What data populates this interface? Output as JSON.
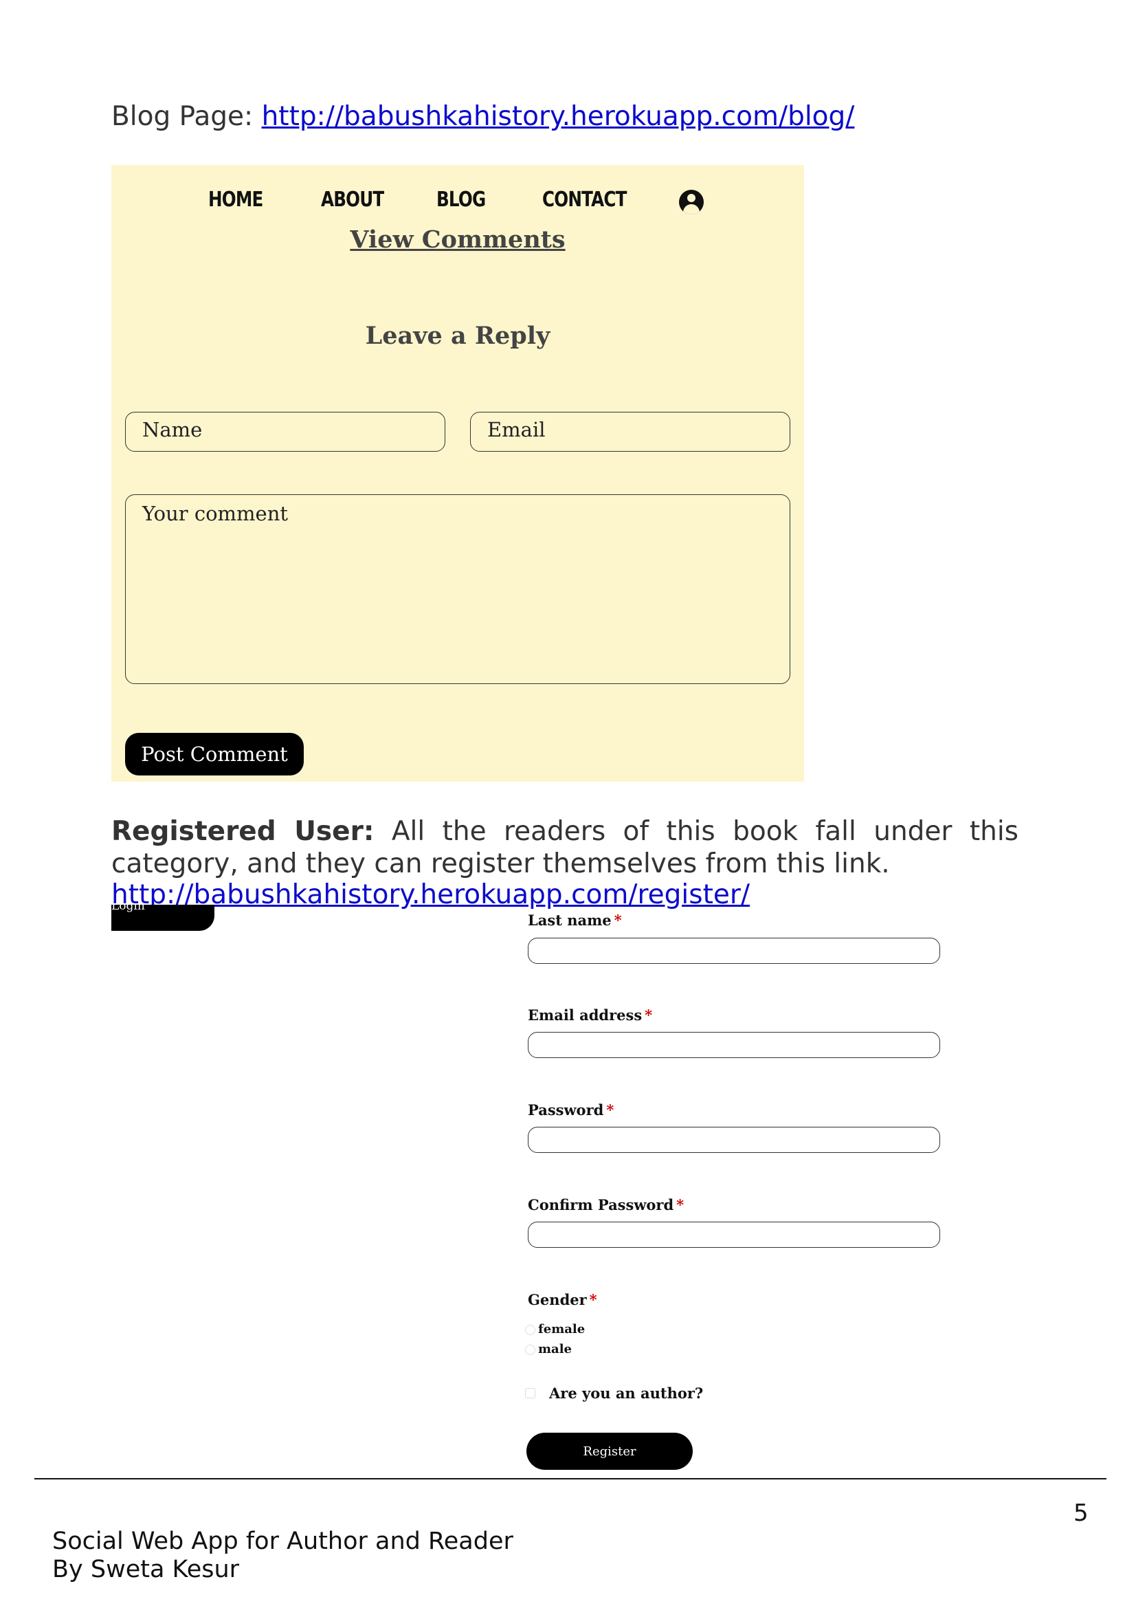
{
  "blog_intro": {
    "label": "Blog Page: ",
    "url": "http://babushkahistory.herokuapp.com/blog/"
  },
  "blog_screenshot": {
    "nav": {
      "home": "HOME",
      "about": "ABOUT",
      "blog": "BLOG",
      "contact": "CONTACT",
      "user_icon": "user-circle-icon"
    },
    "view_comments": "View Comments",
    "leave_reply": "Leave a Reply",
    "name_placeholder": "Name",
    "email_placeholder": "Email",
    "comment_placeholder": "Your comment",
    "post_button": "Post Comment",
    "background_color": "#fdf6cd"
  },
  "registered_user": {
    "heading": "Registered User:",
    "line1_rest": "All the readers of this book fall under this",
    "line2": "category, and they can register themselves from this link.",
    "url": "http://babushkahistory.herokuapp.com/register/"
  },
  "register_screenshot": {
    "login_button": "Login",
    "last_name_label": "Last name",
    "email_label": "Email address",
    "password_label": "Password",
    "confirm_password_label": "Confirm Password",
    "gender_label": "Gender",
    "required_mark": "*",
    "gender_options": [
      "female",
      "male"
    ],
    "author_checkbox": "Are you an author?",
    "register_button": "Register"
  },
  "footer": {
    "page_number": "5",
    "title": "Social Web App for Author and Reader",
    "author": "By Sweta Kesur"
  }
}
